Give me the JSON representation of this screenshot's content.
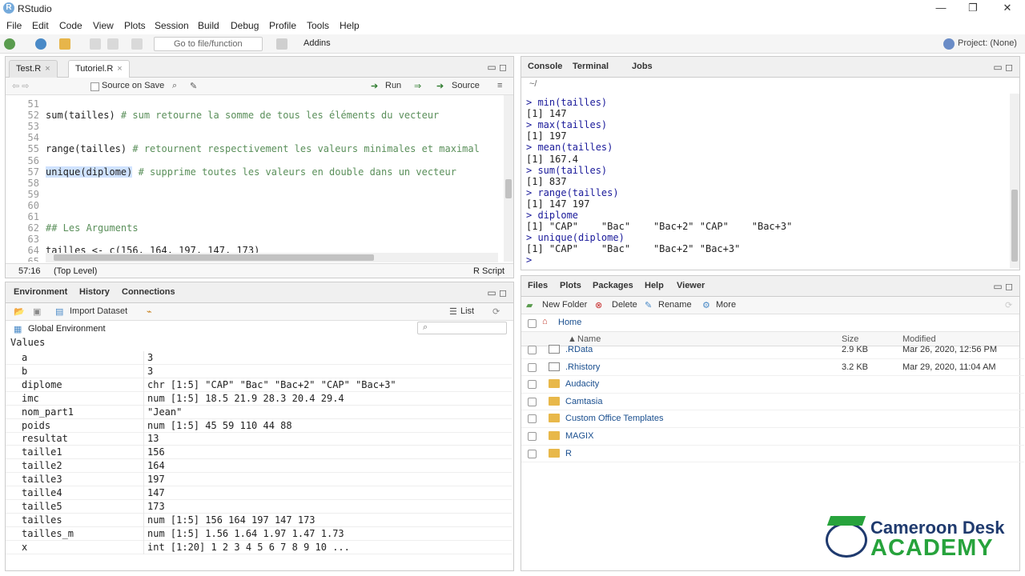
{
  "app": {
    "title": "RStudio",
    "logo": "R"
  },
  "menu": [
    "File",
    "Edit",
    "Code",
    "View",
    "Plots",
    "Session",
    "Build",
    "Debug",
    "Profile",
    "Tools",
    "Help"
  ],
  "toolbar": {
    "goto_placeholder": "Go to file/function",
    "addins": "Addins",
    "project": "Project: (None)"
  },
  "editor": {
    "tabs": [
      {
        "label": "Test.R"
      },
      {
        "label": "Tutoriel.R"
      }
    ],
    "source_on_save": "Source on Save",
    "run": "Run",
    "source": "Source",
    "lines": [
      {
        "n": "51",
        "t": ""
      },
      {
        "n": "52",
        "code": "sum(tailles) ",
        "cmt": "# sum retourne la somme de tous les éléments du vecteur"
      },
      {
        "n": "53",
        "t": ""
      },
      {
        "n": "54",
        "t": ""
      },
      {
        "n": "55",
        "code": "range(tailles) ",
        "cmt": "# retournent respectivement les valeurs minimales et maximal"
      },
      {
        "n": "56",
        "t": ""
      },
      {
        "n": "57",
        "sel": "unique(diplome)",
        "cmt": " # supprime toutes les valeurs en double dans un vecteur"
      },
      {
        "n": "58",
        "t": ""
      },
      {
        "n": "59",
        "t": ""
      },
      {
        "n": "60",
        "t": ""
      },
      {
        "n": "61",
        "t": ""
      },
      {
        "n": "62",
        "cmtonly": "## Les Arguments"
      },
      {
        "n": "63",
        "t": ""
      },
      {
        "n": "64",
        "code": "tailles <- c(156, 164, 197, 147, 173)"
      },
      {
        "n": "65",
        "t": ""
      }
    ],
    "status_pos": "57:16",
    "status_level": "(Top Level)",
    "status_type": "R Script"
  },
  "console": {
    "tabs": [
      "Console",
      "Terminal",
      "Jobs"
    ],
    "path": "~/",
    "lines": [
      {
        "p": "> ",
        "t": "min(tailles)"
      },
      {
        "t": "[1] 147"
      },
      {
        "p": "> ",
        "t": "max(tailles)"
      },
      {
        "t": "[1] 197"
      },
      {
        "p": "> ",
        "t": "mean(tailles)"
      },
      {
        "t": "[1] 167.4"
      },
      {
        "p": "> ",
        "t": "sum(tailles)"
      },
      {
        "t": "[1] 837"
      },
      {
        "p": "> ",
        "t": "range(tailles)"
      },
      {
        "t": "[1] 147 197"
      },
      {
        "p": "> ",
        "t": "diplome"
      },
      {
        "t": "[1] \"CAP\"    \"Bac\"    \"Bac+2\" \"CAP\"    \"Bac+3\""
      },
      {
        "p": "> ",
        "t": "unique(diplome)"
      },
      {
        "t": "[1] \"CAP\"    \"Bac\"    \"Bac+2\" \"Bac+3\""
      },
      {
        "p": "> ",
        "t": ""
      }
    ]
  },
  "env": {
    "tabs": [
      "Environment",
      "History",
      "Connections"
    ],
    "import": "Import Dataset",
    "list": "List",
    "scope": "Global Environment",
    "section": "Values",
    "rows": [
      {
        "name": "a",
        "val": "3"
      },
      {
        "name": "b",
        "val": "3"
      },
      {
        "name": "diplome",
        "val": "chr [1:5] \"CAP\" \"Bac\" \"Bac+2\" \"CAP\" \"Bac+3\""
      },
      {
        "name": "imc",
        "val": "num [1:5] 18.5 21.9 28.3 20.4 29.4"
      },
      {
        "name": "nom_part1",
        "val": "\"Jean\""
      },
      {
        "name": "poids",
        "val": "num [1:5] 45 59 110 44 88"
      },
      {
        "name": "resultat",
        "val": "13"
      },
      {
        "name": "taille1",
        "val": "156"
      },
      {
        "name": "taille2",
        "val": "164"
      },
      {
        "name": "taille3",
        "val": "197"
      },
      {
        "name": "taille4",
        "val": "147"
      },
      {
        "name": "taille5",
        "val": "173"
      },
      {
        "name": "tailles",
        "val": "num [1:5] 156 164 197 147 173"
      },
      {
        "name": "tailles_m",
        "val": "num [1:5] 1.56 1.64 1.97 1.47 1.73"
      },
      {
        "name": "x",
        "val": "int [1:20] 1 2 3 4 5 6 7 8 9 10 ..."
      }
    ]
  },
  "files": {
    "tabs": [
      "Files",
      "Plots",
      "Packages",
      "Help",
      "Viewer"
    ],
    "new_folder": "New Folder",
    "delete": "Delete",
    "rename": "Rename",
    "more": "More",
    "home": "Home",
    "col_name": "Name",
    "col_size": "Size",
    "col_modified": "Modified",
    "rows": [
      {
        "name": ".RData",
        "size": "2.9 KB",
        "mod": "Mar 26, 2020, 12:56 PM",
        "kind": "doc"
      },
      {
        "name": ".Rhistory",
        "size": "3.2 KB",
        "mod": "Mar 29, 2020, 11:04 AM",
        "kind": "doc"
      },
      {
        "name": "Audacity",
        "size": "",
        "mod": "",
        "kind": "folder"
      },
      {
        "name": "Camtasia",
        "size": "",
        "mod": "",
        "kind": "folder"
      },
      {
        "name": "Custom Office Templates",
        "size": "",
        "mod": "",
        "kind": "folder"
      },
      {
        "name": "MAGIX",
        "size": "",
        "mod": "",
        "kind": "folder"
      },
      {
        "name": "R",
        "size": "",
        "mod": "",
        "kind": "folder"
      }
    ]
  },
  "watermark": {
    "line1": "Cameroon Desk",
    "line2": "ACADEMY",
    "color1": "#1f3a6e",
    "color2": "#27a33c"
  }
}
